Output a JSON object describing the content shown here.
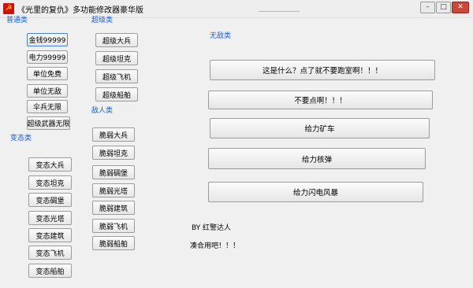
{
  "window": {
    "title": "《光里的复仇》多功能修改器豪华版",
    "app_icon_glyph": "☭",
    "controls": {
      "minimize": "–",
      "maximize": "□",
      "close": "✕"
    }
  },
  "sections": {
    "normal": "普通类",
    "super": "超级类",
    "invincible": "无敌类",
    "mutant": "变态类",
    "enemy": "敌人类"
  },
  "normal_buttons": [
    "金钱99999",
    "电力99999",
    "单位免费",
    "单位无敌",
    "伞兵无限",
    "超级武器无限"
  ],
  "super_buttons": [
    "超级大兵",
    "超级坦克",
    "超级飞机",
    "超级船舶"
  ],
  "mutant_buttons": [
    "变态大兵",
    "变态坦克",
    "变态碉堡",
    "变态光塔",
    "变态建筑",
    "变态飞机",
    "变态船舶"
  ],
  "enemy_buttons": [
    "脆弱大兵",
    "脆弱坦克",
    "脆弱碉堡",
    "脆弱光塔",
    "脆弱建筑",
    "脆弱飞机",
    "脆弱船舶"
  ],
  "wide_buttons": [
    "这是什么？点了就不要跑室啊！！！",
    "不要点啊！！！",
    "给力矿车",
    "给力核弹",
    "给力闪电风暴"
  ],
  "credits": {
    "author": "BY 红警达人",
    "note": "凑合用吧！！！"
  }
}
